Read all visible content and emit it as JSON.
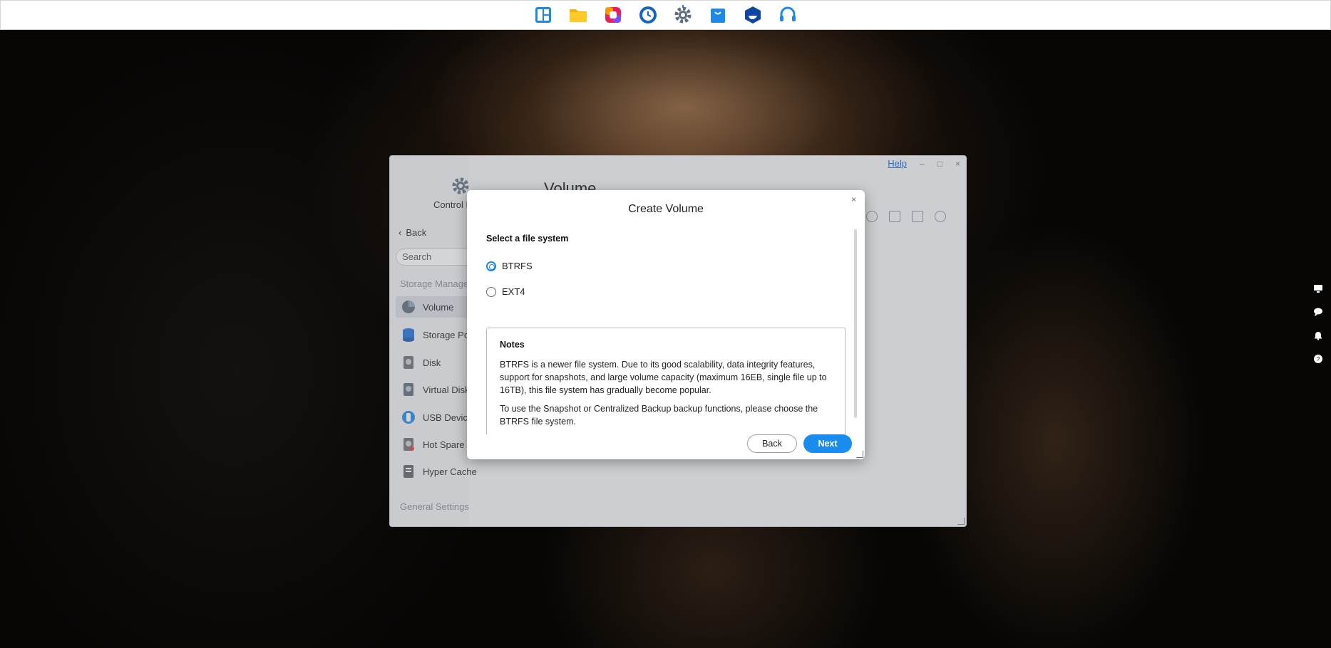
{
  "taskbar": {
    "icons": [
      "layout-icon",
      "folder-icon",
      "photos-icon",
      "clock-icon",
      "settings-gear-icon",
      "store-bag-icon",
      "docker-icon",
      "headset-icon"
    ]
  },
  "window": {
    "app_label": "Control P",
    "page_title": "Volume",
    "help_label": "Help",
    "minimize_label": "–",
    "maximize_label": "□",
    "close_label": "×",
    "back_label": "Back",
    "search_placeholder": "Search",
    "section_storage": "Storage Manage",
    "section_general": "General Settings",
    "nav": [
      {
        "label": "Volume",
        "icon": "volume-pie-icon",
        "color": "#5e6b7a"
      },
      {
        "label": "Storage Po",
        "icon": "storage-pool-icon",
        "color": "#1e6fd9"
      },
      {
        "label": "Disk",
        "icon": "disk-icon",
        "color": "#6b6f75"
      },
      {
        "label": "Virtual Disk",
        "icon": "virtual-disk-icon",
        "color": "#5e6b7a"
      },
      {
        "label": "USB Device",
        "icon": "usb-icon",
        "color": "#1e88e5"
      },
      {
        "label": "Hot Spare",
        "icon": "hot-spare-icon",
        "color": "#6b6f75"
      },
      {
        "label": "Hyper Cache",
        "icon": "hyper-cache-icon",
        "color": "#5a5f66"
      }
    ]
  },
  "modal": {
    "title": "Create Volume",
    "close_label": "×",
    "select_label": "Select a file system",
    "options": [
      {
        "label": "BTRFS",
        "checked": true
      },
      {
        "label": "EXT4",
        "checked": false
      }
    ],
    "notes_title": "Notes",
    "notes_p1": "BTRFS is a newer file system. Due to its good scalability, data integrity features, support for snapshots, and large volume capacity (maximum 16EB, single file up to 16TB), this file system has gradually become popular.",
    "notes_p2": "To use the Snapshot or Centralized Backup backup functions, please choose the BTRFS file system.",
    "back_button": "Back",
    "next_button": "Next"
  },
  "colors": {
    "accent": "#1a8cf0",
    "taskbar_bg": "#ffffff"
  }
}
